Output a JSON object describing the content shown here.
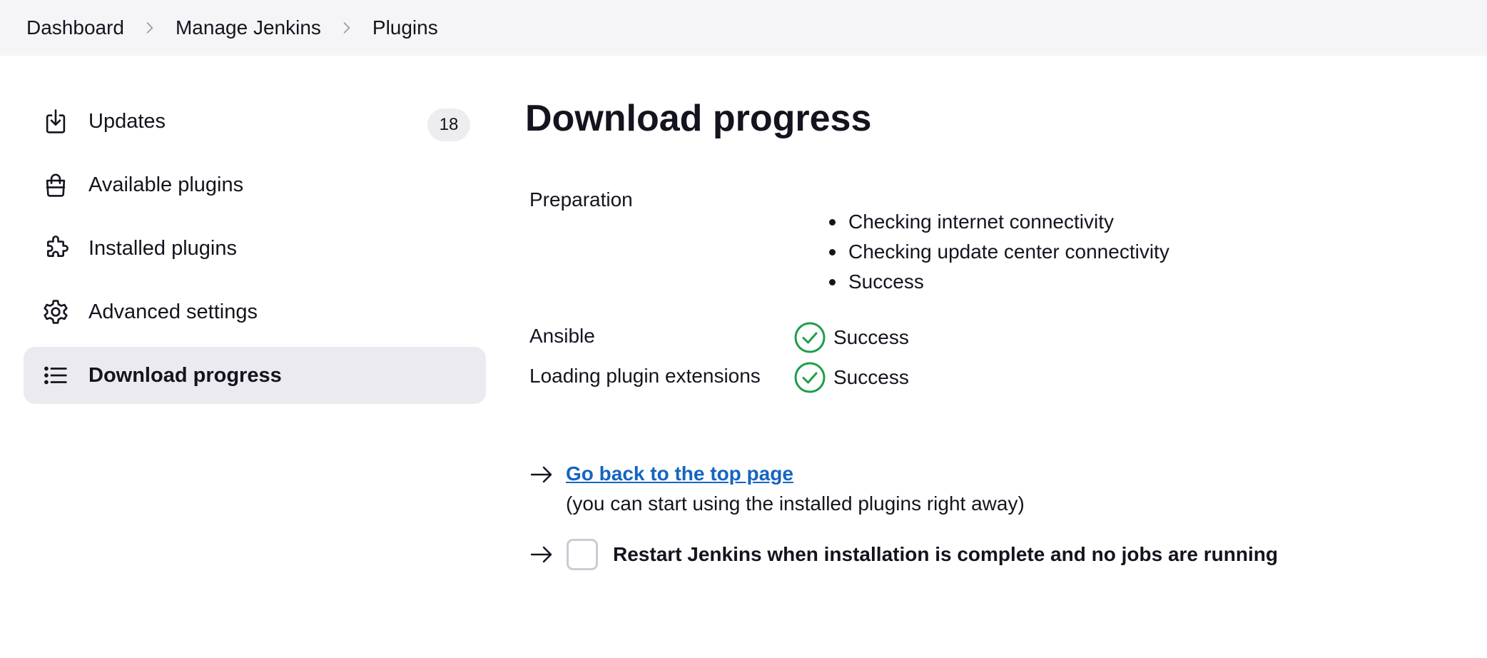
{
  "breadcrumb": [
    "Dashboard",
    "Manage Jenkins",
    "Plugins"
  ],
  "sidebar": {
    "items": [
      {
        "label": "Updates",
        "icon": "download-icon",
        "badge": "18"
      },
      {
        "label": "Available plugins",
        "icon": "shopping-bag-icon"
      },
      {
        "label": "Installed plugins",
        "icon": "puzzle-icon"
      },
      {
        "label": "Advanced settings",
        "icon": "gear-icon"
      },
      {
        "label": "Download progress",
        "icon": "list-icon",
        "active": true
      }
    ]
  },
  "main": {
    "title": "Download progress",
    "preparation": {
      "label": "Preparation",
      "steps": [
        "Checking internet connectivity",
        "Checking update center connectivity",
        "Success"
      ]
    },
    "plugins": [
      {
        "name": "Ansible",
        "status": "Success",
        "icon": "success-check-icon"
      },
      {
        "name": "Loading plugin extensions",
        "status": "Success",
        "icon": "success-check-icon"
      }
    ],
    "back_link": "Go back to the top page",
    "back_hint": "(you can start using the installed plugins right away)",
    "restart_label": "Restart Jenkins when installation is complete and no jobs are running",
    "restart_checked": false
  },
  "colors": {
    "link": "#1565c0",
    "success": "#1e9e4a",
    "active_bg": "#ebebef",
    "topbar_bg": "#f5f5f7"
  }
}
